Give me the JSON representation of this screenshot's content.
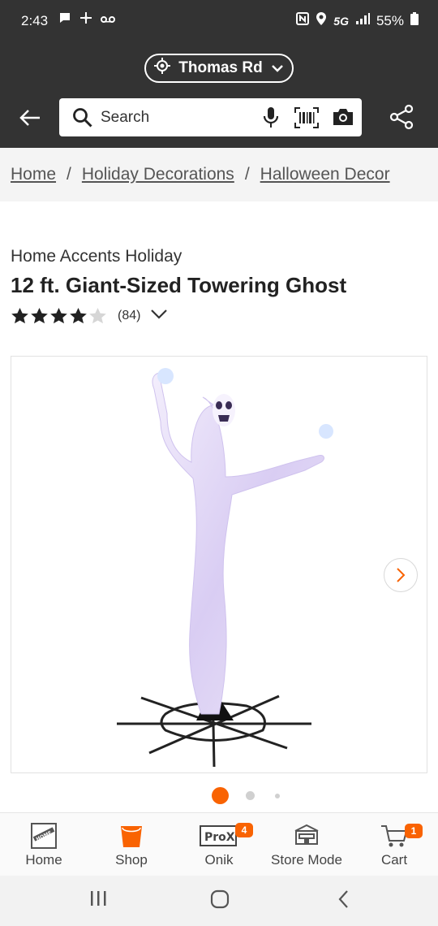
{
  "status_bar": {
    "time": "2:43",
    "network": "5G",
    "battery": "55%"
  },
  "header": {
    "store_name": "Thomas Rd",
    "search": {
      "placeholder": "Search"
    }
  },
  "breadcrumb": [
    {
      "label": "Home"
    },
    {
      "label": "Holiday Decorations"
    },
    {
      "label": "Halloween Decor"
    }
  ],
  "product": {
    "brand": "Home Accents Holiday",
    "title": "12 ft. Giant-Sized Towering Ghost",
    "rating": 4,
    "rating_max": 5,
    "review_count": "(84)"
  },
  "carousel": {
    "image_alt": "Giant-Sized Towering Ghost",
    "active_index": 0,
    "dots": 3
  },
  "tab_bar": [
    {
      "label": "Home",
      "icon": "home-depot-logo-icon"
    },
    {
      "label": "Shop",
      "icon": "bucket-icon"
    },
    {
      "label": "Onik",
      "icon": "pro-x-icon",
      "badge": "4",
      "icon_text": "ProX"
    },
    {
      "label": "Store Mode",
      "icon": "store-icon"
    },
    {
      "label": "Cart",
      "icon": "cart-icon",
      "badge": "1"
    }
  ],
  "colors": {
    "header_bg": "#333333",
    "accent": "#f96302",
    "breadcrumb_bg": "#f4f4f4"
  }
}
